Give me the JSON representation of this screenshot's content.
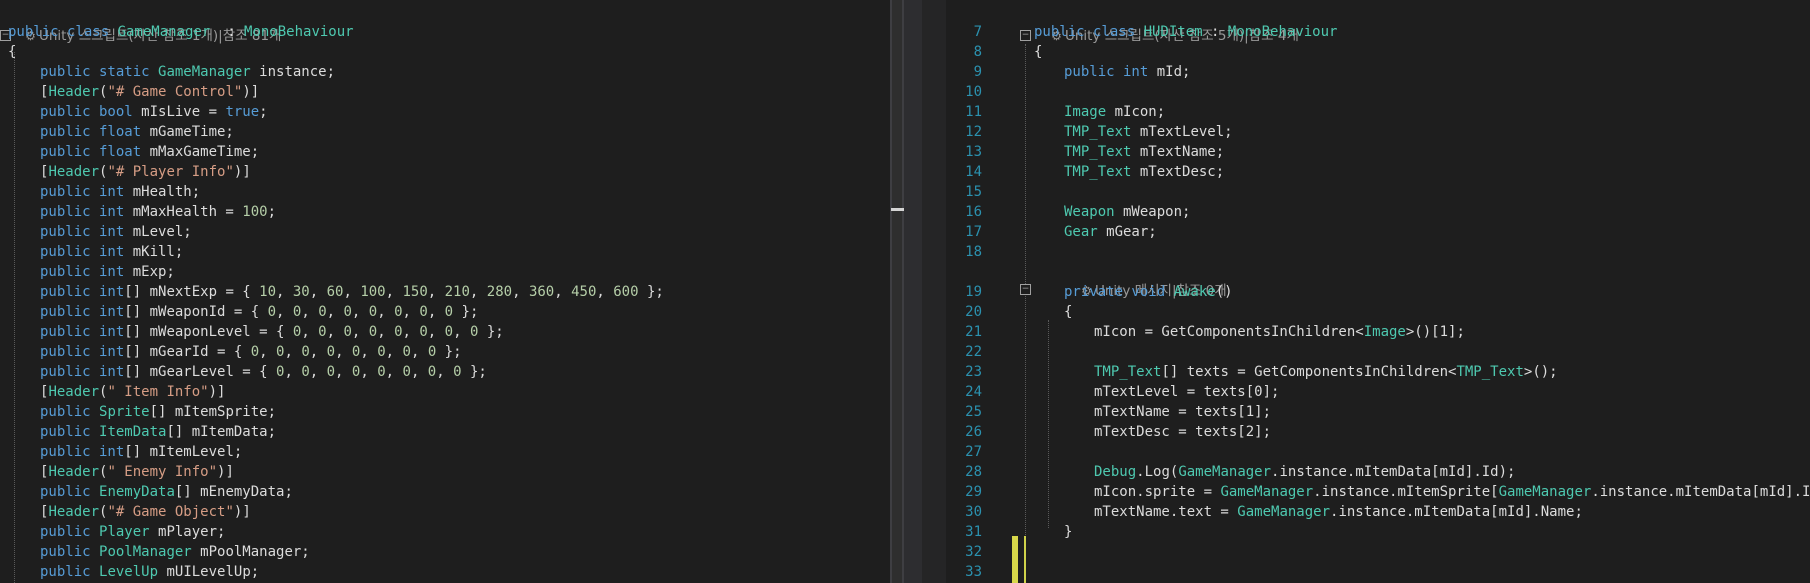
{
  "left_editor": {
    "codelens": "Unity 스크립트(자산 참조 1개)|참조 81개",
    "lines": [
      [
        [
          "k",
          "public class "
        ],
        [
          "t",
          "GameManager"
        ],
        [
          "",
          "  : "
        ],
        [
          "t",
          "MonoBehaviour"
        ]
      ],
      [
        [
          "",
          "{"
        ]
      ],
      [
        [
          "k",
          "public static "
        ],
        [
          "t",
          "GameManager"
        ],
        [
          "",
          " instance;"
        ]
      ],
      [
        [
          "",
          "["
        ],
        [
          "t",
          "Header"
        ],
        [
          "",
          "("
        ],
        [
          "s",
          "\"# Game Control\""
        ],
        [
          "",
          ")]"
        ]
      ],
      [
        [
          "k",
          "public bool "
        ],
        [
          "",
          "mIsLive = "
        ],
        [
          "k",
          "true"
        ],
        [
          "",
          ";"
        ]
      ],
      [
        [
          "k",
          "public float "
        ],
        [
          "",
          "mGameTime;"
        ]
      ],
      [
        [
          "k",
          "public float "
        ],
        [
          "",
          "mMaxGameTime;"
        ]
      ],
      [
        [
          "",
          "["
        ],
        [
          "t",
          "Header"
        ],
        [
          "",
          "("
        ],
        [
          "s",
          "\"# Player Info\""
        ],
        [
          "",
          ")]"
        ]
      ],
      [
        [
          "k",
          "public int "
        ],
        [
          "",
          "mHealth;"
        ]
      ],
      [
        [
          "k",
          "public int "
        ],
        [
          "",
          "mMaxHealth = "
        ],
        [
          "n",
          "100"
        ],
        [
          "",
          ";"
        ]
      ],
      [
        [
          "k",
          "public int "
        ],
        [
          "",
          "mLevel;"
        ]
      ],
      [
        [
          "k",
          "public int "
        ],
        [
          "",
          "mKill;"
        ]
      ],
      [
        [
          "k",
          "public int "
        ],
        [
          "",
          "mExp;"
        ]
      ],
      [
        [
          "k",
          "public int"
        ],
        [
          "",
          "[] mNextExp = { "
        ],
        [
          "n",
          "10"
        ],
        [
          "",
          ", "
        ],
        [
          "n",
          "30"
        ],
        [
          "",
          ", "
        ],
        [
          "n",
          "60"
        ],
        [
          "",
          ", "
        ],
        [
          "n",
          "100"
        ],
        [
          "",
          ", "
        ],
        [
          "n",
          "150"
        ],
        [
          "",
          ", "
        ],
        [
          "n",
          "210"
        ],
        [
          "",
          ", "
        ],
        [
          "n",
          "280"
        ],
        [
          "",
          ", "
        ],
        [
          "n",
          "360"
        ],
        [
          "",
          ", "
        ],
        [
          "n",
          "450"
        ],
        [
          "",
          ", "
        ],
        [
          "n",
          "600"
        ],
        [
          "",
          " };"
        ]
      ],
      [
        [
          "k",
          "public int"
        ],
        [
          "",
          "[] mWeaponId = { "
        ],
        [
          "n",
          "0"
        ],
        [
          "",
          ", "
        ],
        [
          "n",
          "0"
        ],
        [
          "",
          ", "
        ],
        [
          "n",
          "0"
        ],
        [
          "",
          ", "
        ],
        [
          "n",
          "0"
        ],
        [
          "",
          ", "
        ],
        [
          "n",
          "0"
        ],
        [
          "",
          ", "
        ],
        [
          "n",
          "0"
        ],
        [
          "",
          ", "
        ],
        [
          "n",
          "0"
        ],
        [
          "",
          ", "
        ],
        [
          "n",
          "0"
        ],
        [
          "",
          " };"
        ]
      ],
      [
        [
          "k",
          "public int"
        ],
        [
          "",
          "[] mWeaponLevel = { "
        ],
        [
          "n",
          "0"
        ],
        [
          "",
          ", "
        ],
        [
          "n",
          "0"
        ],
        [
          "",
          ", "
        ],
        [
          "n",
          "0"
        ],
        [
          "",
          ", "
        ],
        [
          "n",
          "0"
        ],
        [
          "",
          ", "
        ],
        [
          "n",
          "0"
        ],
        [
          "",
          ", "
        ],
        [
          "n",
          "0"
        ],
        [
          "",
          ", "
        ],
        [
          "n",
          "0"
        ],
        [
          "",
          ", "
        ],
        [
          "n",
          "0"
        ],
        [
          "",
          " };"
        ]
      ],
      [
        [
          "k",
          "public int"
        ],
        [
          "",
          "[] mGearId = { "
        ],
        [
          "n",
          "0"
        ],
        [
          "",
          ", "
        ],
        [
          "n",
          "0"
        ],
        [
          "",
          ", "
        ],
        [
          "n",
          "0"
        ],
        [
          "",
          ", "
        ],
        [
          "n",
          "0"
        ],
        [
          "",
          ", "
        ],
        [
          "n",
          "0"
        ],
        [
          "",
          ", "
        ],
        [
          "n",
          "0"
        ],
        [
          "",
          ", "
        ],
        [
          "n",
          "0"
        ],
        [
          "",
          ", "
        ],
        [
          "n",
          "0"
        ],
        [
          "",
          " };"
        ]
      ],
      [
        [
          "k",
          "public int"
        ],
        [
          "",
          "[] mGearLevel = { "
        ],
        [
          "n",
          "0"
        ],
        [
          "",
          ", "
        ],
        [
          "n",
          "0"
        ],
        [
          "",
          ", "
        ],
        [
          "n",
          "0"
        ],
        [
          "",
          ", "
        ],
        [
          "n",
          "0"
        ],
        [
          "",
          ", "
        ],
        [
          "n",
          "0"
        ],
        [
          "",
          ", "
        ],
        [
          "n",
          "0"
        ],
        [
          "",
          ", "
        ],
        [
          "n",
          "0"
        ],
        [
          "",
          ", "
        ],
        [
          "n",
          "0"
        ],
        [
          "",
          " };"
        ]
      ],
      [
        [
          "",
          "["
        ],
        [
          "t",
          "Header"
        ],
        [
          "",
          "("
        ],
        [
          "s",
          "\" Item Info\""
        ],
        [
          "",
          ")]"
        ]
      ],
      [
        [
          "k",
          "public "
        ],
        [
          "t",
          "Sprite"
        ],
        [
          "",
          "[] mItemSprite;"
        ]
      ],
      [
        [
          "k",
          "public "
        ],
        [
          "t",
          "ItemData"
        ],
        [
          "",
          "[] mItemData;"
        ]
      ],
      [
        [
          "k",
          "public int"
        ],
        [
          "",
          "[] mItemLevel;"
        ]
      ],
      [
        [
          "",
          "["
        ],
        [
          "t",
          "Header"
        ],
        [
          "",
          "("
        ],
        [
          "s",
          "\" Enemy Info\""
        ],
        [
          "",
          ")]"
        ]
      ],
      [
        [
          "k",
          "public "
        ],
        [
          "t",
          "EnemyData"
        ],
        [
          "",
          "[] mEnemyData;"
        ]
      ],
      [
        [
          "",
          "["
        ],
        [
          "t",
          "Header"
        ],
        [
          "",
          "("
        ],
        [
          "s",
          "\"# Game Object\""
        ],
        [
          "",
          ")]"
        ]
      ],
      [
        [
          "k",
          "public "
        ],
        [
          "t",
          "Player"
        ],
        [
          "",
          " mPlayer;"
        ]
      ],
      [
        [
          "k",
          "public "
        ],
        [
          "t",
          "PoolManager"
        ],
        [
          "",
          " mPoolManager;"
        ]
      ],
      [
        [
          "k",
          "public "
        ],
        [
          "t",
          "LevelUp"
        ],
        [
          "",
          " mUILevelUp;"
        ]
      ]
    ]
  },
  "right_editor": {
    "codelens_top": "Unity 스크립트(자산 참조 5개)|참조 4개",
    "codelens_awake": "Unity 메시지|참조 0개",
    "rows": [
      {
        "n": "7",
        "c": [
          [
            "k",
            "public class "
          ],
          [
            "t",
            "HUDItem"
          ],
          [
            "",
            " : "
          ],
          [
            "t",
            "MonoBehaviour"
          ]
        ]
      },
      {
        "n": "8",
        "c": [
          [
            "",
            "{"
          ]
        ]
      },
      {
        "n": "9",
        "c": [
          [
            "k",
            "public int "
          ],
          [
            "",
            "mId;"
          ]
        ]
      },
      {
        "n": "10",
        "c": []
      },
      {
        "n": "11",
        "c": [
          [
            "t",
            "Image"
          ],
          [
            "",
            " mIcon;"
          ]
        ]
      },
      {
        "n": "12",
        "c": [
          [
            "t",
            "TMP_Text"
          ],
          [
            "",
            " mTextLevel;"
          ]
        ]
      },
      {
        "n": "13",
        "c": [
          [
            "t",
            "TMP_Text"
          ],
          [
            "",
            " mTextName;"
          ]
        ]
      },
      {
        "n": "14",
        "c": [
          [
            "t",
            "TMP_Text"
          ],
          [
            "",
            " mTextDesc;"
          ]
        ]
      },
      {
        "n": "15",
        "c": []
      },
      {
        "n": "16",
        "c": [
          [
            "t",
            "Weapon"
          ],
          [
            "",
            " mWeapon;"
          ]
        ]
      },
      {
        "n": "17",
        "c": [
          [
            "t",
            "Gear"
          ],
          [
            "",
            " mGear;"
          ]
        ]
      },
      {
        "n": "18",
        "c": []
      },
      {
        "n": "19",
        "c": [
          [
            "k",
            "private void "
          ],
          [
            "t",
            "Awake"
          ],
          [
            "",
            "()"
          ]
        ]
      },
      {
        "n": "20",
        "c": [
          [
            "",
            "{"
          ]
        ]
      },
      {
        "n": "21",
        "c": [
          [
            "",
            "mIcon = GetComponentsInChildren<"
          ],
          [
            "t",
            "Image"
          ],
          [
            "",
            ">()[1];"
          ]
        ]
      },
      {
        "n": "22",
        "c": []
      },
      {
        "n": "23",
        "c": [
          [
            "t",
            "TMP_Text"
          ],
          [
            "",
            "[] texts = GetComponentsInChildren<"
          ],
          [
            "t",
            "TMP_Text"
          ],
          [
            "",
            ">();"
          ]
        ]
      },
      {
        "n": "24",
        "c": [
          [
            "",
            "mTextLevel = texts[0];"
          ]
        ]
      },
      {
        "n": "25",
        "c": [
          [
            "",
            "mTextName = texts[1];"
          ]
        ]
      },
      {
        "n": "26",
        "c": [
          [
            "",
            "mTextDesc = texts[2];"
          ]
        ]
      },
      {
        "n": "27",
        "c": []
      },
      {
        "n": "28",
        "c": [
          [
            "t",
            "Debug"
          ],
          [
            "",
            ".Log("
          ],
          [
            "t",
            "GameManager"
          ],
          [
            "",
            ".instance.mItemData[mId].Id);"
          ]
        ]
      },
      {
        "n": "29",
        "c": [
          [
            "",
            "mIcon.sprite = "
          ],
          [
            "t",
            "GameManager"
          ],
          [
            "",
            ".instance.mItemSprite["
          ],
          [
            "t",
            "GameManager"
          ],
          [
            "",
            ".instance.mItemData[mId].Id];"
          ]
        ]
      },
      {
        "n": "30",
        "c": [
          [
            "",
            "mTextName.text = "
          ],
          [
            "t",
            "GameManager"
          ],
          [
            "",
            ".instance.mItemData[mId].Name;"
          ]
        ]
      },
      {
        "n": "31",
        "c": [
          [
            "",
            "}"
          ]
        ]
      },
      {
        "n": "32",
        "c": []
      },
      {
        "n": "33",
        "c": []
      }
    ]
  }
}
